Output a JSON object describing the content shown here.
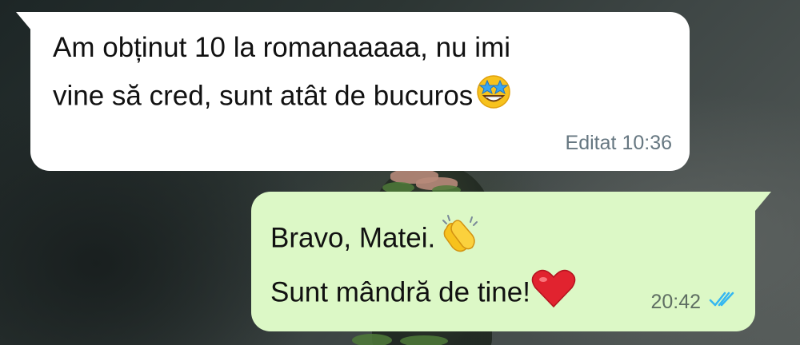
{
  "chat": {
    "messages": [
      {
        "direction": "incoming",
        "lines": [
          "Am obținut 10 la romanaaaaa, nu imi",
          "vine să cred, sunt atât de bucuros"
        ],
        "emoji": "star-struck-emoji",
        "edited_label": "Editat",
        "time": "10:36"
      },
      {
        "direction": "outgoing",
        "lines": [
          "Bravo, Matei.",
          "Sunt mândră de tine!"
        ],
        "emojis": [
          "clapping-hands-emoji",
          "red-heart-emoji"
        ],
        "time": "20:42",
        "status_icon": "double-check-read-icon"
      }
    ]
  },
  "colors": {
    "incoming_bubble": "#ffffff",
    "outgoing_bubble": "#dcf8c6",
    "read_check": "#34b7f1",
    "meta_text": "#667781"
  }
}
